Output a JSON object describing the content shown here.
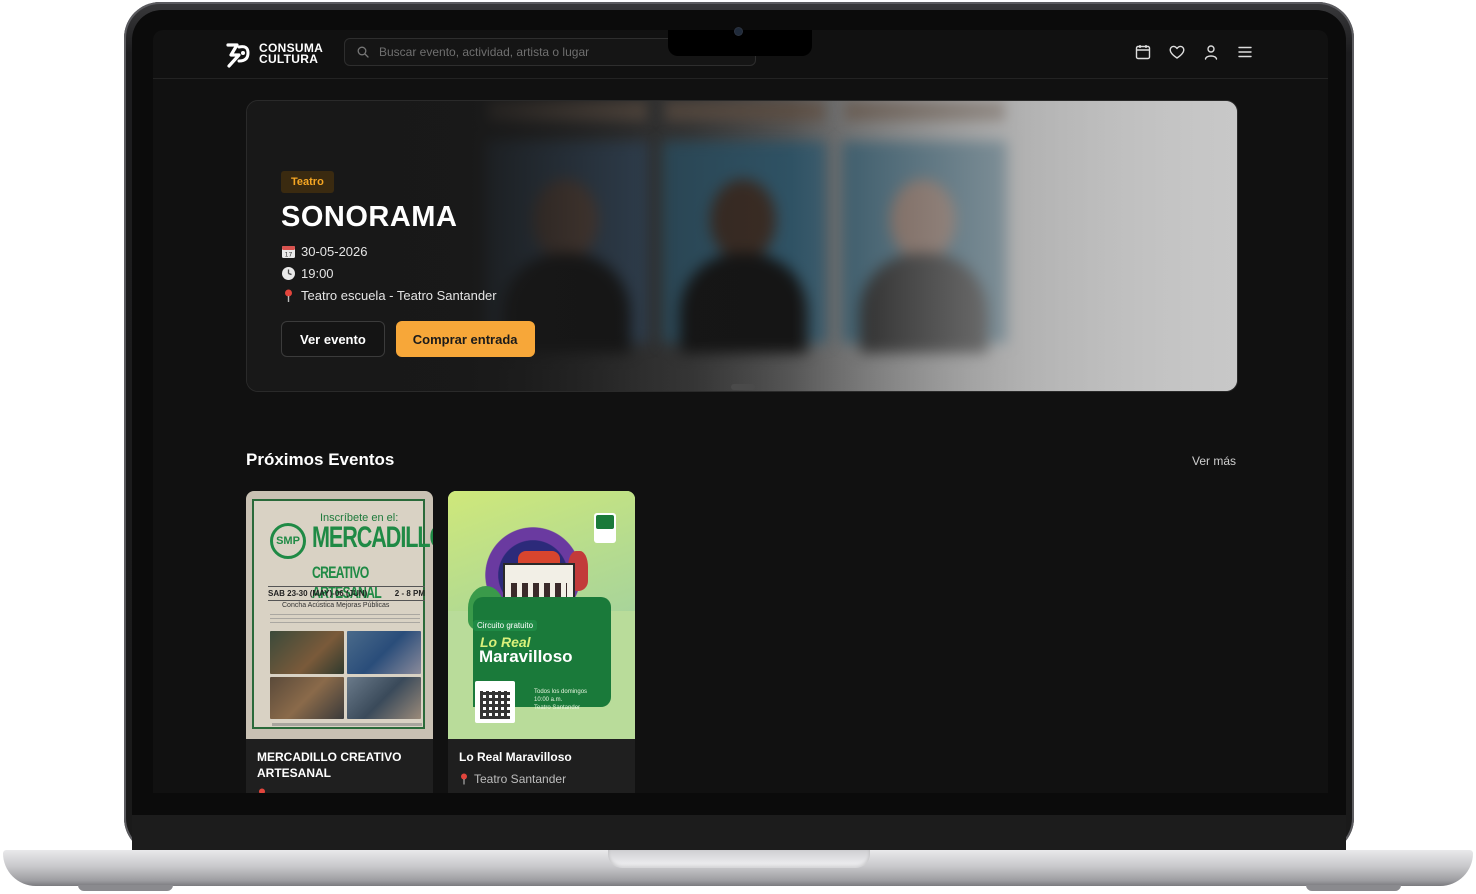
{
  "header": {
    "logo_line1": "CONSUMA",
    "logo_line2": "CULTURA",
    "search_placeholder": "Buscar evento, actividad, artista o lugar",
    "icons": [
      "calendar-icon",
      "heart-icon",
      "user-icon",
      "menu-icon"
    ]
  },
  "hero": {
    "category": "Teatro",
    "title": "SONORAMA",
    "date": "30-05-2026",
    "time": "19:00",
    "location": "Teatro escuela - Teatro Santander",
    "view_button": "Ver evento",
    "buy_button": "Comprar entrada"
  },
  "section": {
    "title": "Próximos Eventos",
    "see_more": "Ver más"
  },
  "events": [
    {
      "name": "MERCADILLO CREATIVO ARTESANAL",
      "poster": {
        "heading": "Inscríbete en el:",
        "big": "MERCADILLO",
        "sub": "CREATIVO ARTESANAL",
        "emblem": "SMP",
        "dates": "SAB 23-30 (MAY)-06 (JUN)",
        "hours": "2 - 8 PM",
        "place": "Concha Acústica Mejoras Públicas"
      }
    },
    {
      "name": "Lo Real Maravilloso",
      "location": "Teatro Santander",
      "poster": {
        "chip": "Circuito gratuito",
        "title_top": "Lo Real",
        "title_bottom": "Maravilloso",
        "info1": "Todos los domingos",
        "info2": "10:00 a.m.",
        "info3": "Teatro Santander"
      }
    }
  ],
  "colors": {
    "accent": "#f7a739",
    "badge_text": "#f5a623",
    "background": "#111111"
  }
}
